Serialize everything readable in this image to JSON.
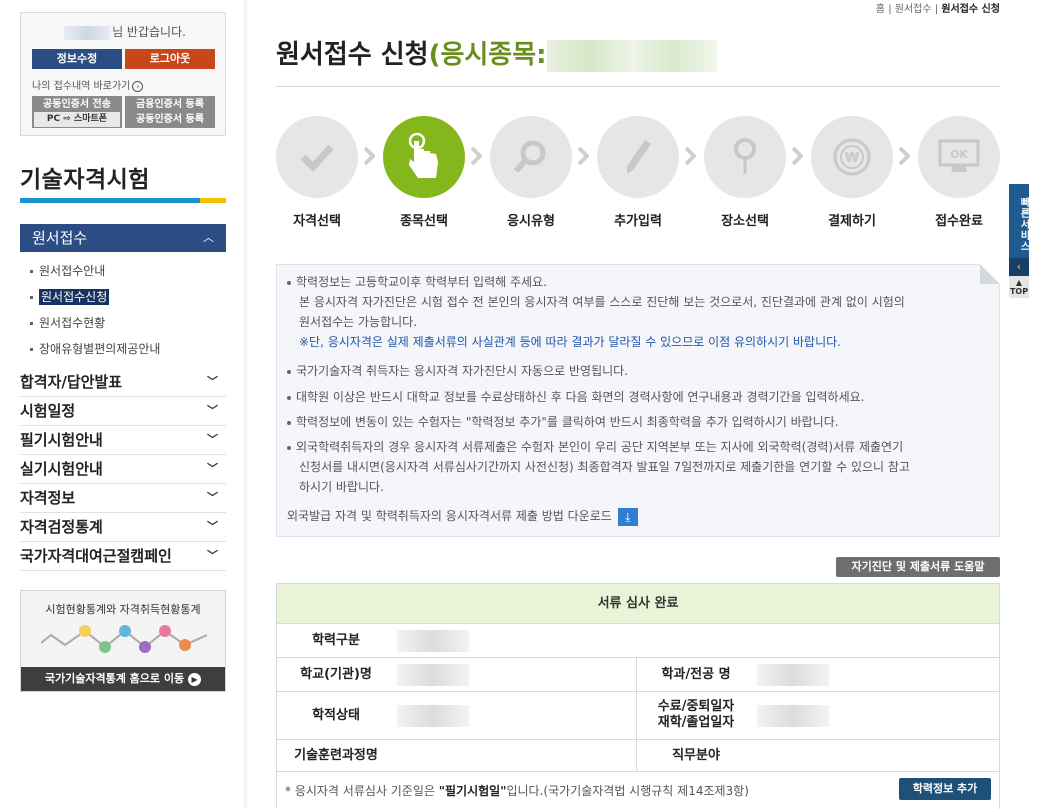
{
  "sidebar": {
    "greeting": "님 반갑습니다.",
    "edit_btn": "정보수정",
    "logout_btn": "로그아웃",
    "quick_link": "나의 접수내역 바로가기",
    "cert_send_line1": "공동인증서 전송",
    "cert_send_line2": "PC ⇨ 스마트폰",
    "cert_reg_line1": "금융인증서 등록",
    "cert_reg_line2": "공동인증서 등록",
    "section_title": "기술자격시험",
    "active_menu": "원서접수",
    "sub_items": [
      {
        "label": "원서접수안내"
      },
      {
        "label": "원서접수신청"
      },
      {
        "label": "원서접수현황"
      },
      {
        "label": "장애유형별편의제공안내"
      }
    ],
    "menu_items": [
      {
        "label": "합격자/답안발표"
      },
      {
        "label": "시험일정"
      },
      {
        "label": "필기시험안내"
      },
      {
        "label": "실기시험안내"
      },
      {
        "label": "자격정보"
      },
      {
        "label": "자격검정통계"
      },
      {
        "label": "국가자격대여근절캠페인"
      }
    ],
    "banner_title": "시험현황통계와 자격취득현황통계",
    "banner_link": "국가기술자격통계 홈으로 이동"
  },
  "breadcrumb": {
    "home": "홈",
    "sep": "|",
    "level1": "원서접수",
    "current": "원서접수 신청"
  },
  "page_title": {
    "main": "원서접수 신청",
    "sub_prefix": "(응시종목:"
  },
  "steps": [
    {
      "label": "자격선택",
      "icon": "check-icon",
      "active": false
    },
    {
      "label": "종목선택",
      "icon": "hand-pointer-icon",
      "active": true
    },
    {
      "label": "응시유형",
      "icon": "magnifier-icon",
      "active": false
    },
    {
      "label": "추가입력",
      "icon": "pencil-icon",
      "active": false
    },
    {
      "label": "장소선택",
      "icon": "location-pin-icon",
      "active": false
    },
    {
      "label": "결제하기",
      "icon": "won-coin-icon",
      "active": false
    },
    {
      "label": "접수완료",
      "icon": "ok-monitor-icon",
      "active": false
    }
  ],
  "notice": {
    "l1": "학력정보는 고등학교이후 학력부터 입력해 주세요.",
    "l2": "본 응시자격 자가진단은 시험 접수 전 본인의 응시자격 여부를 스스로 진단해 보는 것으로서, 진단결과에 관계 없이 시험의",
    "l3": "원서접수는 가능합니다.",
    "l4": "※단, 응시자격은 실제 제출서류의 사실관계 등에 따라 결과가 달라질 수 있으므로 이점 유의하시기 바랍니다.",
    "l5": "국가기술자격 취득자는 응시자격 자가진단시 자동으로 반영됩니다.",
    "l6": "대학원 이상은 반드시 대학교 정보를 수료상태하신 후 다음 화면의 경력사항에 연구내용과 경력기간을 입력하세요.",
    "l7": "학력정보에 변동이 있는 수험자는 \"학력정보 추가\"를 클릭하여 반드시 최종학력을 추가 입력하시기 바랍니다.",
    "l8": "외국학력취득자의 경우 응시자격 서류제출은 수험자 본인이 우리 공단 지역본부 또는 지사에 외국학력(경력)서류 제출연기",
    "l9": "신청서를 내시면(응시자격 서류심사기간까지 사전신청) 최종합격자 발표일 7일전까지로 제출기한을 연기할 수 있으니 참고",
    "l10": "하시기 바랍니다.",
    "l11": "외국발급 자격 및 학력취득자의 응시자격서류 제출 방법 다운로드"
  },
  "help_btn": "자기진단 및 제출서류 도움말",
  "table": {
    "header": "서류 심사 완료",
    "r1_label": "학력구분",
    "r2_label1": "학교(기관)명",
    "r2_label2": "학과/전공 명",
    "r3_label1": "학적상태",
    "r3_label2a": "수료/중퇴일자",
    "r3_label2b": "재학/졸업일자",
    "r4_label1": "기술훈련과정명",
    "r4_label2": "직무분야",
    "note_prefix": "* 응시자격 서류심사 기준일은 ",
    "note_bold": "\"필기시험일\"",
    "note_suffix": "입니다.(국가기술자격법 시행규칙 제14조제3항)",
    "add_btn": "학력정보 추가"
  },
  "quickbar": {
    "label": "빠른서비스",
    "top": "TOP"
  },
  "colors": {
    "navy": "#2c4c84",
    "green": "#84b71b",
    "orange": "#c7471a",
    "blue": "#1a93d2"
  }
}
